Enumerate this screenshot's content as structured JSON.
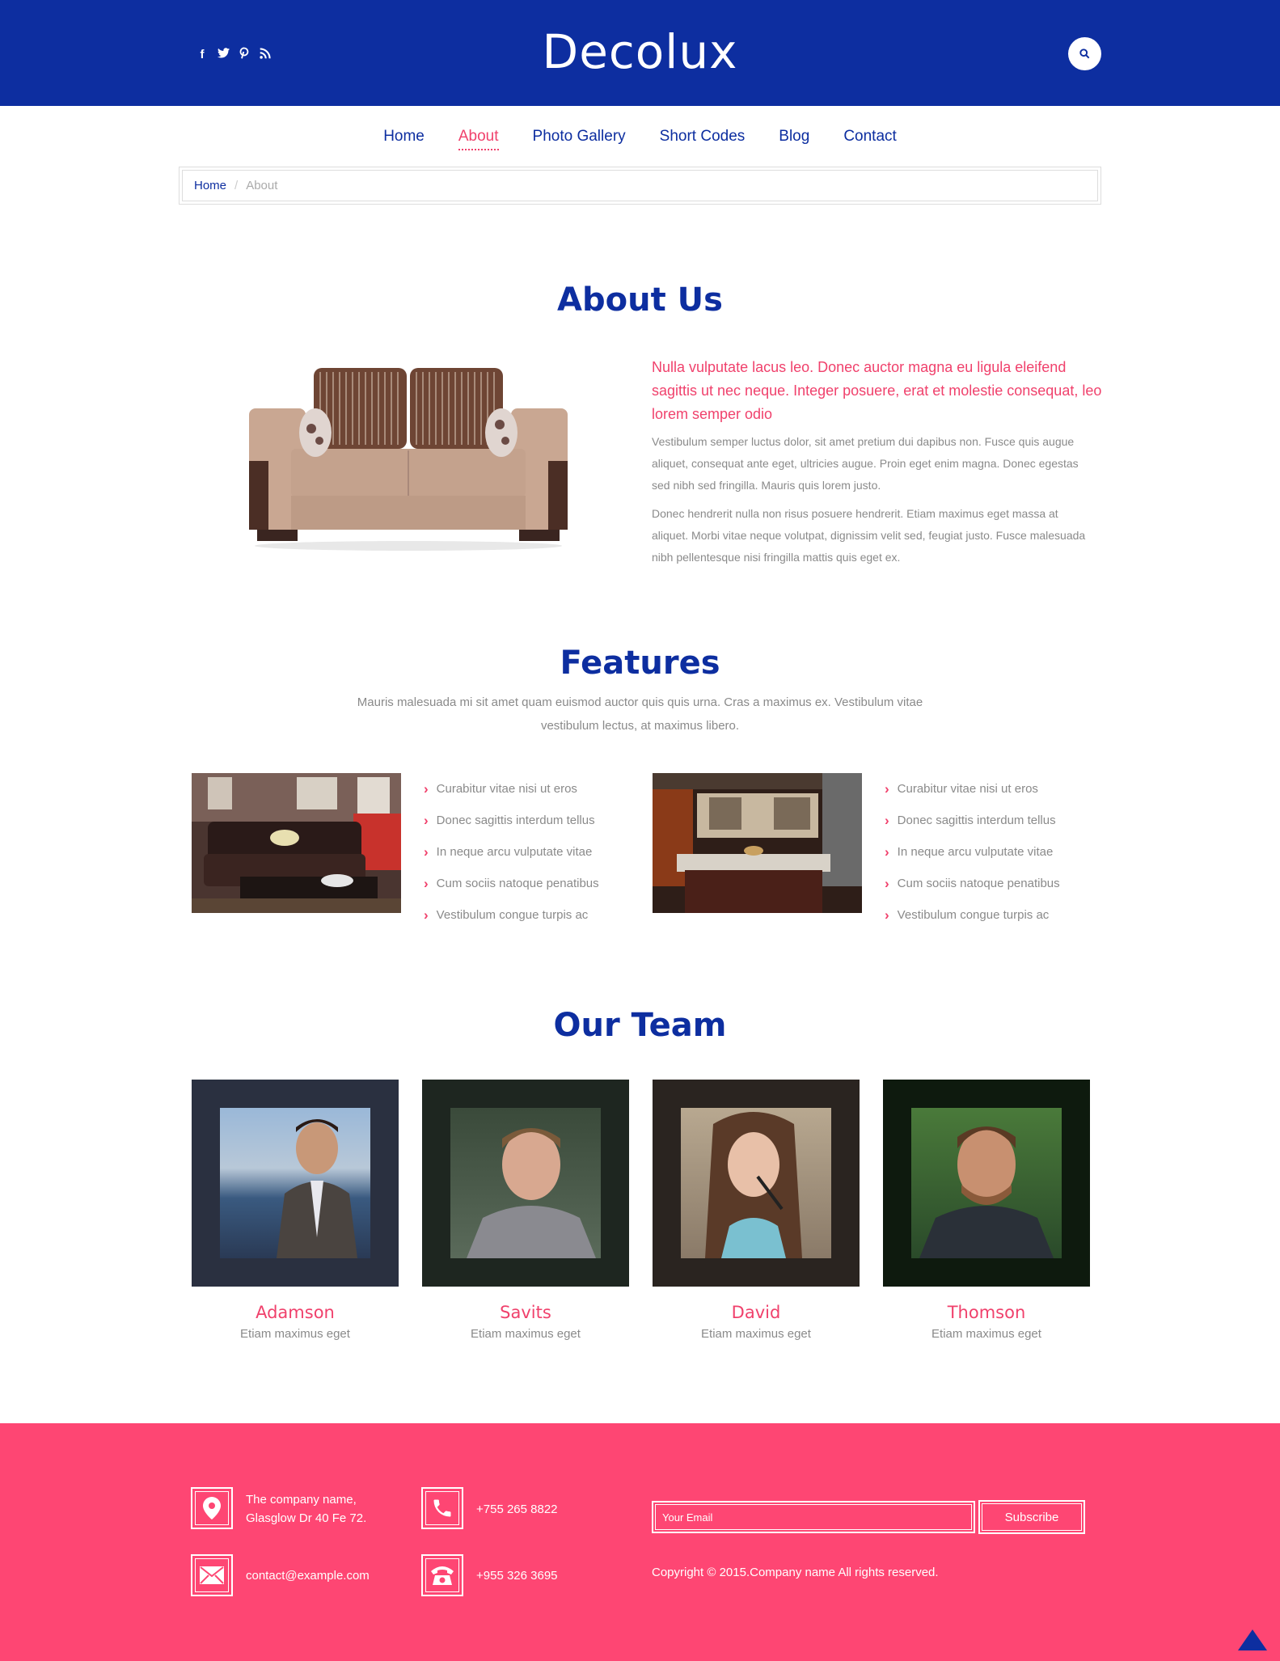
{
  "header": {
    "logo": "Decolux",
    "social": [
      {
        "icon": "facebook-icon",
        "glyph": "f"
      },
      {
        "icon": "twitter-icon",
        "glyph": "t"
      },
      {
        "icon": "pinterest-icon",
        "glyph": "p"
      },
      {
        "icon": "rss-icon",
        "glyph": "r"
      }
    ],
    "search_icon": "search-icon"
  },
  "nav": {
    "items": [
      {
        "label": "Home"
      },
      {
        "label": "About",
        "active": true
      },
      {
        "label": "Photo Gallery"
      },
      {
        "label": "Short Codes"
      },
      {
        "label": "Blog"
      },
      {
        "label": "Contact"
      }
    ]
  },
  "breadcrumb": {
    "home": "Home",
    "separator": "/",
    "current": "About"
  },
  "about": {
    "title": "About Us",
    "lead": "Nulla vulputate lacus leo. Donec auctor magna eu ligula eleifend sagittis ut nec neque. Integer posuere, erat et molestie consequat, leo lorem semper odio",
    "paragraphs": [
      "Vestibulum semper luctus dolor, sit amet pretium dui dapibus non. Fusce quis augue aliquet, consequat ante eget, ultricies augue. Proin eget enim magna. Donec egestas sed nibh sed fringilla. Mauris quis lorem justo.",
      "Donec hendrerit nulla non risus posuere hendrerit. Etiam maximus eget massa at aliquet. Morbi vitae neque volutpat, dignissim velit sed, feugiat justo. Fusce malesuada nibh pellentesque nisi fringilla mattis quis eget ex."
    ]
  },
  "features": {
    "title": "Features",
    "description": "Mauris malesuada mi sit amet quam euismod auctor quis quis urna. Cras a maximus ex. Vestibulum vitae vestibulum lectus, at maximus libero.",
    "lists": [
      [
        "Curabitur vitae nisi ut eros",
        "Donec sagittis interdum tellus",
        "In neque arcu vulputate vitae",
        "Cum sociis natoque penatibus",
        "Vestibulum congue turpis ac"
      ],
      [
        "Curabitur vitae nisi ut eros",
        "Donec sagittis interdum tellus",
        "In neque arcu vulputate vitae",
        "Cum sociis natoque penatibus",
        "Vestibulum congue turpis ac"
      ]
    ]
  },
  "team": {
    "title": "Our Team",
    "members": [
      {
        "name": "Adamson",
        "role": "Etiam maximus eget"
      },
      {
        "name": "Savits",
        "role": "Etiam maximus eget"
      },
      {
        "name": "David",
        "role": "Etiam maximus eget"
      },
      {
        "name": "Thomson",
        "role": "Etiam maximus eget"
      }
    ]
  },
  "footer": {
    "address_line1": "The company name,",
    "address_line2": "Glasglow Dr 40 Fe 72.",
    "phone1": "+755 265 8822",
    "email": "contact@example.com",
    "phone2": "+955 326 3695",
    "email_placeholder": "Your Email",
    "subscribe_label": "Subscribe",
    "copyright": "Copyright © 2015.Company name All rights reserved."
  },
  "colors": {
    "primary": "#0d2ea0",
    "accent": "#f0416c",
    "footer_bg": "#fe4673"
  }
}
